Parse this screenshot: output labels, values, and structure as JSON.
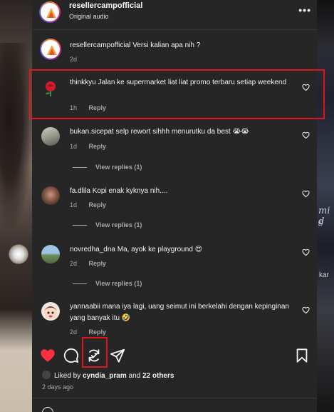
{
  "post": {
    "username": "resellercampofficial",
    "audio": "Original audio",
    "more_icon": "•••"
  },
  "caption": {
    "username": "resellercampofficial",
    "text": "Versi kalian apa nih ?",
    "time": "2d"
  },
  "comments": [
    {
      "username": "thinkkyu",
      "text": "Jalan ke supermarket liat liat promo terbaru setiap weekend",
      "time": "1h",
      "reply": "Reply",
      "avatar": "rose-avatar"
    },
    {
      "username": "bukan.sicepat",
      "text": "selp rewort sihhh menurutku da best 😭😭",
      "time": "1d",
      "reply": "Reply",
      "view_replies": "View replies (1)",
      "avatar": "person-avatar"
    },
    {
      "username": "fa.dlila",
      "text": "Kopi enak kyknya nih....",
      "time": "1d",
      "reply": "Reply",
      "view_replies": "View replies (1)",
      "avatar": "person-avatar"
    },
    {
      "username": "novredha_dna",
      "text": "Ma, ayok ke playground 😍",
      "time": "2d",
      "reply": "Reply",
      "view_replies": "View replies (1)",
      "avatar": "person-avatar"
    },
    {
      "username": "yannaabii",
      "text": "mana iya lagi, uang seimut ini berkelahi dengan kepinginan yang banyak itu 🤣",
      "time": "2d",
      "reply": "Reply",
      "avatar": "cartoon-avatar"
    }
  ],
  "likes": {
    "prefix": "Liked by",
    "user": "cyndia_pram",
    "and": "and",
    "others": "22 others"
  },
  "posted_ago": "2 days ago",
  "colors": {
    "panel_bg": "#262626",
    "like_red": "#ff3040",
    "highlight_red": "#e0151b",
    "muted_text": "#a8a8a8"
  },
  "background_text": {
    "right_1": "mi d",
    "right_2": "s",
    "right_3": "kar"
  }
}
